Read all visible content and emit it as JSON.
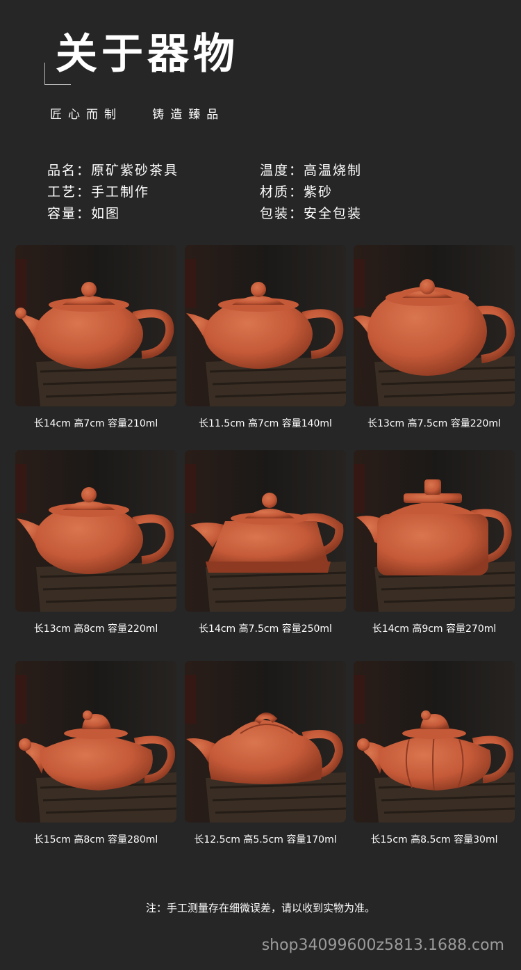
{
  "header": {
    "title": "关于器物",
    "subtitle": "匠心而制   铸造臻品"
  },
  "specs": {
    "name": "品名：原矿紫砂茶具",
    "craft": "工艺：手工制作",
    "capacity": "容量：如图",
    "temperature": "温度：高温烧制",
    "material": "材质：紫砂",
    "packaging": "包装：安全包装"
  },
  "products": [
    {
      "caption": "长14cm 高7cm 容量210ml",
      "style": "xishi-dragon"
    },
    {
      "caption": "长11.5cm 高7cm 容量140ml",
      "style": "xishi"
    },
    {
      "caption": "长13cm 高7.5cm 容量220ml",
      "style": "xishi-large"
    },
    {
      "caption": "长13cm 高8cm 容量220ml",
      "style": "xishi"
    },
    {
      "caption": "长14cm 高7.5cm 容量250ml",
      "style": "shipiao"
    },
    {
      "caption": "长14cm 高9cm 容量270ml",
      "style": "dezhong"
    },
    {
      "caption": "长15cm 高8cm 容量280ml",
      "style": "lion-lid"
    },
    {
      "caption": "长12.5cm 高5.5cm 容量170ml",
      "style": "ziye"
    },
    {
      "caption": "长15cm 高8.5cm 容量30ml",
      "style": "lion-melon"
    }
  ],
  "colors": {
    "background": "#262626",
    "clay": "#c55a38",
    "clay_dark": "#8e3a22",
    "wood": "#3a2e24"
  },
  "note": "注：手工测量存在细微误差，请以收到实物为准。",
  "watermark": "shop34099600z5813.1688.com"
}
